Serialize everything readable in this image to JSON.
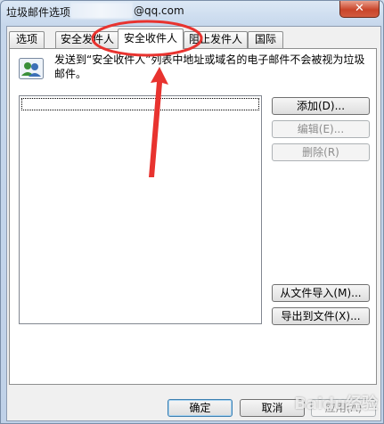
{
  "window": {
    "title": "垃圾邮件选项",
    "title_email": "@qq.com",
    "close_symbol": "✕"
  },
  "tabs": [
    {
      "label": "选项",
      "active": false
    },
    {
      "label": "安全发件人",
      "active": false
    },
    {
      "label": "安全收件人",
      "active": true
    },
    {
      "label": "阻止发件人",
      "active": false
    },
    {
      "label": "国际",
      "active": false
    }
  ],
  "panel": {
    "icon": "contacts-icon",
    "description": "发送到“安全收件人”列表中地址或域名的电子邮件不会被视为垃圾邮件。",
    "list_items": []
  },
  "side_buttons": {
    "add": "添加(D)...",
    "edit": "编辑(E)...",
    "delete": "删除(R)",
    "import": "从文件导入(M)...",
    "export": "导出到文件(X)..."
  },
  "dialog_buttons": {
    "ok": "确定",
    "cancel": "取消",
    "apply": "应用(A)"
  },
  "watermark": "Baidu经验",
  "colors": {
    "annotation": "#e8332f"
  }
}
